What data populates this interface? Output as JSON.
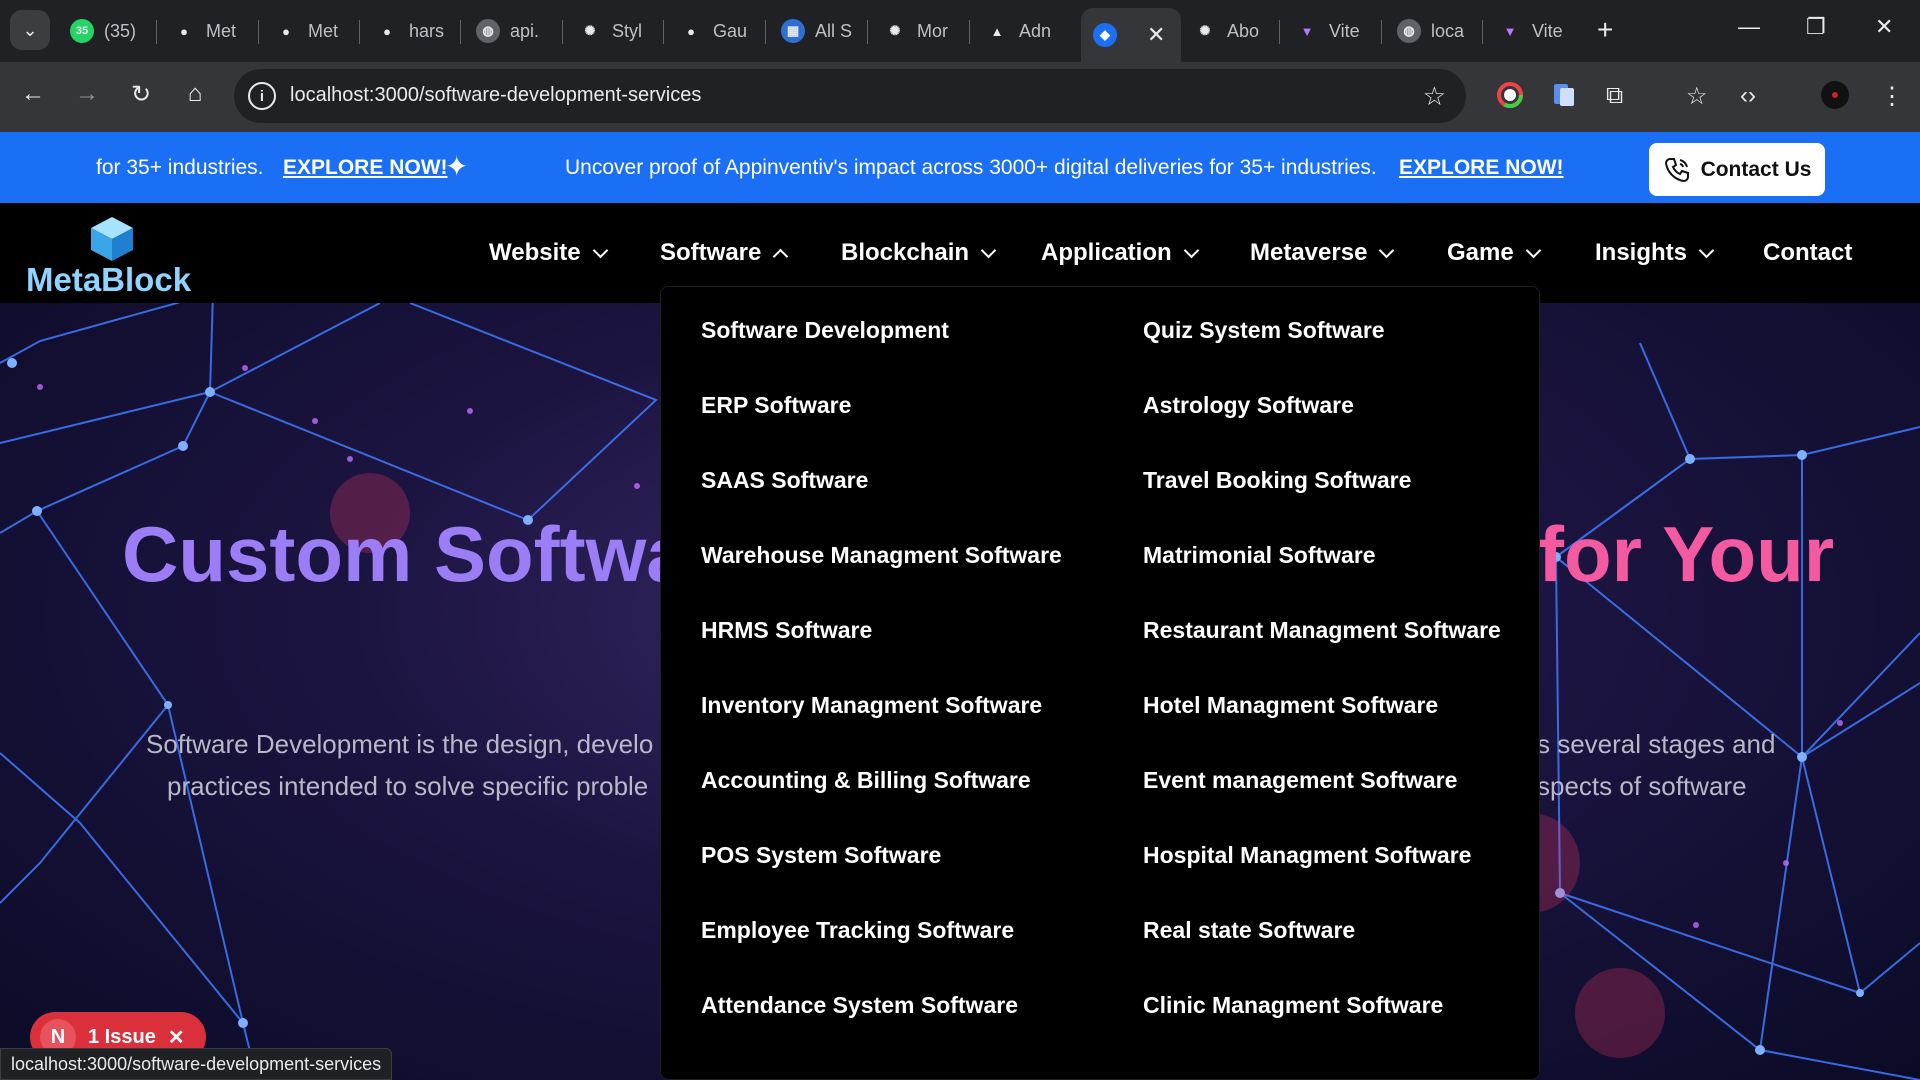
{
  "browser": {
    "tabs": [
      {
        "label": "(35)",
        "icon": "whatsapp-icon",
        "icon_color": "#25d366",
        "badge": "35"
      },
      {
        "label": "Met",
        "icon": "github-icon"
      },
      {
        "label": "Met",
        "icon": "github-icon"
      },
      {
        "label": "hars",
        "icon": "github-icon"
      },
      {
        "label": "api.",
        "icon": "globe-icon"
      },
      {
        "label": "Styl",
        "icon": "openai-icon"
      },
      {
        "label": "Gau",
        "icon": "github-icon"
      },
      {
        "label": "All S",
        "icon": "app-icon"
      },
      {
        "label": "Mor",
        "icon": "openai-icon"
      },
      {
        "label": "Adn",
        "icon": "triangle-icon"
      },
      {
        "label": "",
        "icon": "metablock-icon",
        "active": true
      },
      {
        "label": "Abo",
        "icon": "openai-icon"
      },
      {
        "label": "Vite",
        "icon": "vite-icon"
      },
      {
        "label": "loca",
        "icon": "globe-icon"
      },
      {
        "label": "Vite",
        "icon": "vite-icon"
      }
    ],
    "url": "localhost:3000/software-development-services",
    "status_url": "localhost:3000/software-development-services"
  },
  "promo": {
    "text_left": "for 35+ industries.",
    "link_left": "EXPLORE NOW!",
    "text_main": "Uncover proof of Appinventiv's impact across 3000+ digital deliveries for 35+ industries.",
    "link_main": "EXPLORE NOW!",
    "contact_label": "Contact Us",
    "bar_color": "#1a6ff5"
  },
  "nav": {
    "logo_text": "MetaBlock",
    "items": [
      {
        "label": "Website",
        "chevron": "down"
      },
      {
        "label": "Software",
        "chevron": "up"
      },
      {
        "label": "Blockchain",
        "chevron": "down"
      },
      {
        "label": "Application",
        "chevron": "down"
      },
      {
        "label": "Metaverse",
        "chevron": "down"
      },
      {
        "label": "Game",
        "chevron": "down"
      },
      {
        "label": "Insights",
        "chevron": "down"
      },
      {
        "label": "Contact",
        "chevron": ""
      }
    ]
  },
  "dropdown": {
    "left": [
      "Software Development",
      "ERP Software",
      "SAAS Software",
      "Warehouse Managment Software",
      "HRMS Software",
      "Inventory Managment Software",
      "Accounting & Billing Software",
      "POS System Software",
      "Employee Tracking Software",
      "Attendance System Software"
    ],
    "right": [
      "Quiz System Software",
      "Astrology Software",
      "Travel Booking Software",
      "Matrimonial Software",
      "Restaurant Managment Software",
      "Hotel Managment Software",
      "Event management Software",
      "Hospital Managment Software",
      "Real state Software",
      "Clinic Managment Software"
    ]
  },
  "hero": {
    "title_left": "Custom Softwar",
    "title_right": "for Your",
    "desc_left_1": "Software Development is the design, develo",
    "desc_left_2": "practices intended to solve specific proble",
    "desc_right_1": "s several stages and",
    "desc_right_2": "spects of software",
    "title_color_left": "#9b7df5",
    "title_color_right": "#f45aa0"
  },
  "dev_overlay": {
    "letter": "N",
    "label": "1 Issue"
  }
}
